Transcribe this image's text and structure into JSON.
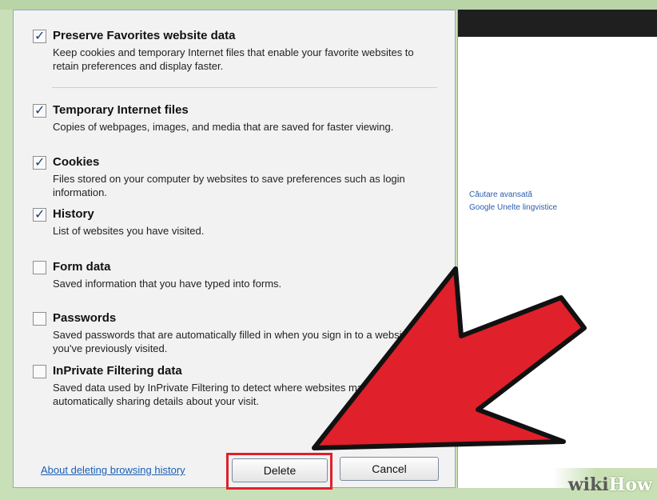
{
  "dialog": {
    "options": [
      {
        "id": "preserve-favorites",
        "checked": true,
        "title": "Preserve Favorites website data",
        "description": "Keep cookies and temporary Internet files that enable your favorite websites to retain preferences and display faster."
      },
      {
        "id": "temporary-internet-files",
        "checked": true,
        "title": "Temporary Internet files",
        "description": "Copies of webpages, images, and media that are saved for faster viewing."
      },
      {
        "id": "cookies",
        "checked": true,
        "title": "Cookies",
        "description": "Files stored on your computer by websites to save preferences such as login information."
      },
      {
        "id": "history",
        "checked": true,
        "title": "History",
        "description": "List of websites you have visited."
      },
      {
        "id": "form-data",
        "checked": false,
        "title": "Form data",
        "description": "Saved information that you have typed into forms."
      },
      {
        "id": "passwords",
        "checked": false,
        "title": "Passwords",
        "description": "Saved passwords that are automatically filled in when you sign in to a website you've previously visited."
      },
      {
        "id": "inprivate-filtering",
        "checked": false,
        "title": "InPrivate Filtering data",
        "description": "Saved data used by InPrivate Filtering to detect where websites may be automatically sharing details about your visit."
      }
    ],
    "check_glyph": "✓",
    "about_link": "About deleting browsing history",
    "delete_label": "Delete",
    "cancel_label": "Cancel"
  },
  "browser": {
    "links": [
      "Căutare avansată",
      "Google Unelte lingvistice"
    ]
  },
  "watermark": {
    "wiki": "wiki",
    "how": "How"
  },
  "colors": {
    "highlight": "#e0202a",
    "arrow": "#e0202a",
    "link": "#1a5fb4"
  },
  "icons": {
    "checkbox": "checkbox-icon",
    "arrow": "red-arrow-annotation"
  }
}
